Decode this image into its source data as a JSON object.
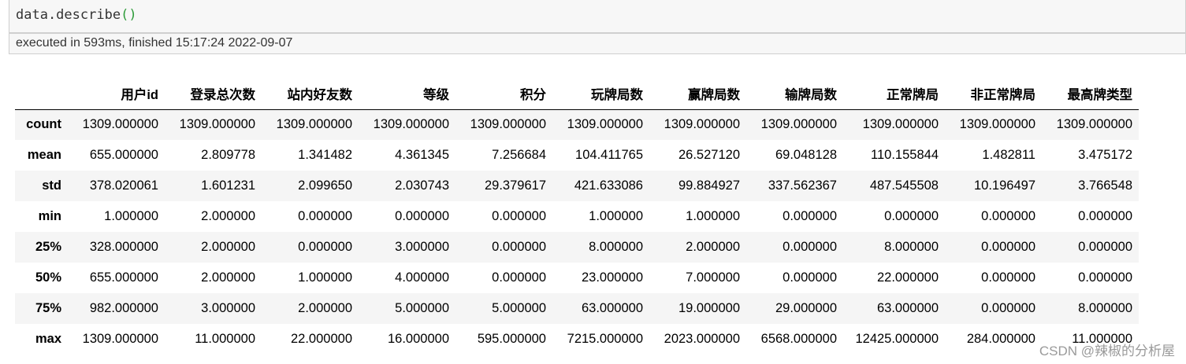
{
  "cell": {
    "code_prefix": "data.describe",
    "code_open": "(",
    "code_close": ")",
    "exec_text": "executed in 593ms, finished 15:17:24 2022-09-07"
  },
  "table": {
    "columns": [
      "用户id",
      "登录总次数",
      "站内好友数",
      "等级",
      "积分",
      "玩牌局数",
      "赢牌局数",
      "输牌局数",
      "正常牌局",
      "非正常牌局",
      "最高牌类型"
    ],
    "rows": [
      {
        "label": "count",
        "values": [
          "1309.000000",
          "1309.000000",
          "1309.000000",
          "1309.000000",
          "1309.000000",
          "1309.000000",
          "1309.000000",
          "1309.000000",
          "1309.000000",
          "1309.000000",
          "1309.000000"
        ]
      },
      {
        "label": "mean",
        "values": [
          "655.000000",
          "2.809778",
          "1.341482",
          "4.361345",
          "7.256684",
          "104.411765",
          "26.527120",
          "69.048128",
          "110.155844",
          "1.482811",
          "3.475172"
        ]
      },
      {
        "label": "std",
        "values": [
          "378.020061",
          "1.601231",
          "2.099650",
          "2.030743",
          "29.379617",
          "421.633086",
          "99.884927",
          "337.562367",
          "487.545508",
          "10.196497",
          "3.766548"
        ]
      },
      {
        "label": "min",
        "values": [
          "1.000000",
          "2.000000",
          "0.000000",
          "0.000000",
          "0.000000",
          "1.000000",
          "1.000000",
          "0.000000",
          "0.000000",
          "0.000000",
          "0.000000"
        ]
      },
      {
        "label": "25%",
        "values": [
          "328.000000",
          "2.000000",
          "0.000000",
          "3.000000",
          "0.000000",
          "8.000000",
          "2.000000",
          "0.000000",
          "8.000000",
          "0.000000",
          "0.000000"
        ]
      },
      {
        "label": "50%",
        "values": [
          "655.000000",
          "2.000000",
          "1.000000",
          "4.000000",
          "0.000000",
          "23.000000",
          "7.000000",
          "0.000000",
          "22.000000",
          "0.000000",
          "0.000000"
        ]
      },
      {
        "label": "75%",
        "values": [
          "982.000000",
          "3.000000",
          "2.000000",
          "5.000000",
          "5.000000",
          "63.000000",
          "19.000000",
          "29.000000",
          "63.000000",
          "0.000000",
          "8.000000"
        ]
      },
      {
        "label": "max",
        "values": [
          "1309.000000",
          "11.000000",
          "22.000000",
          "16.000000",
          "595.000000",
          "7215.000000",
          "2023.000000",
          "6568.000000",
          "12425.000000",
          "284.000000",
          "11.000000"
        ]
      }
    ]
  },
  "watermark": "CSDN @辣椒的分析屋"
}
